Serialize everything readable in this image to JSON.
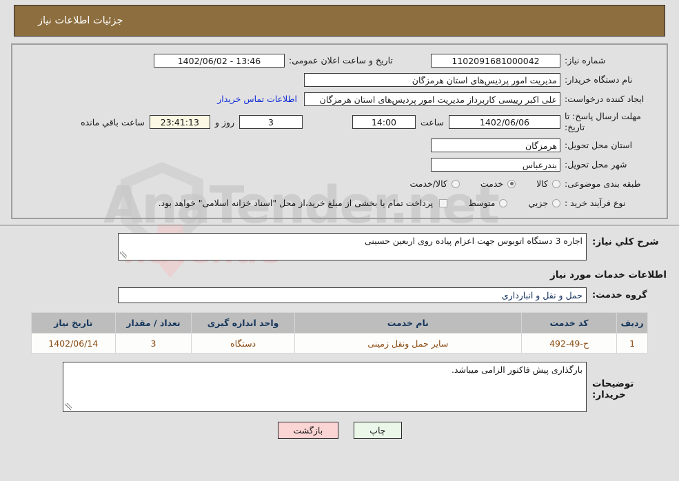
{
  "header": {
    "title": "جزئیات اطلاعات نیاز"
  },
  "form": {
    "need_number_label": "شماره نیاز:",
    "need_number_value": "1102091681000042",
    "announce_label": "تاریخ و ساعت اعلان عمومی:",
    "announce_value": "1402/06/02 - 13:46",
    "buyer_org_label": "نام دستگاه خریدار:",
    "buyer_org_value": "مدیریت امور پردیس‌های استان هرمزگان",
    "creator_label": "ایجاد کننده درخواست:",
    "creator_value": "علی اکبر رییسی کاربرداز مدیریت امور پردیس‌های استان هرمزگان",
    "contact_link": "اطلاعات تماس خریدار",
    "deadline_label_line1": "مهلت ارسال پاسخ: تا",
    "deadline_label_line2": "تاریخ:",
    "deadline_date": "1402/06/06",
    "hour_label": "ساعت",
    "hour_value": "14:00",
    "days_value": "3",
    "days_label": "روز و",
    "timer_value": "23:41:13",
    "remaining_label": "ساعت باقي مانده",
    "province_label": "استان محل تحویل:",
    "province_value": "هرمزگان",
    "city_label": "شهر محل تحویل:",
    "city_value": "بندرعباس",
    "category_label": "طبقه بندی موضوعی:",
    "category_options": [
      {
        "label": "کالا",
        "checked": false
      },
      {
        "label": "خدمت",
        "checked": true
      },
      {
        "label": "کالا/خدمت",
        "checked": false
      }
    ],
    "process_label": "نوع فرآیند خرید :",
    "process_options": [
      {
        "label": "جزیي",
        "checked": false
      },
      {
        "label": "متوسط",
        "checked": false
      }
    ],
    "treasury_note": "پرداخت تمام یا بخشی از مبلغ خرید،از محل \"اسناد خزانه اسلامی\" خواهد بود."
  },
  "description": {
    "label": "شرح کلي نیاز:",
    "value": "اجاره 3 دستگاه اتوبوس جهت اعزام پیاده روی اربعین حسینی"
  },
  "services": {
    "heading": "اطلاعات خدمات مورد نیاز",
    "group_label": "گروه خدمت:",
    "group_value": "حمل و نقل و انبارداری",
    "columns": [
      "ردیف",
      "کد خدمت",
      "نام خدمت",
      "واحد اندازه گیری",
      "تعداد / مقدار",
      "تاریخ نیاز"
    ],
    "rows": [
      {
        "radif": "1",
        "code": "ح-49-492",
        "name": "سایر حمل ونقل زمینی",
        "unit": "دستگاه",
        "qty": "3",
        "date": "1402/06/14"
      }
    ]
  },
  "notes": {
    "label": "توضیحات خریدار:",
    "value": "بارگذاری پیش فاکتور الزامی میباشد."
  },
  "buttons": {
    "print": "چاپ",
    "back": "بازگشت"
  },
  "colors": {
    "header_bar": "#8d6e3f",
    "page_background": "#e1e1e1",
    "link": "#0e2ad6",
    "table_header": "#bdbdbd",
    "table_cell_text": "#8a4b12",
    "timer_background": "#fbf8e3",
    "print_button": "#eaf7e9",
    "back_button": "#fbd4d4"
  }
}
